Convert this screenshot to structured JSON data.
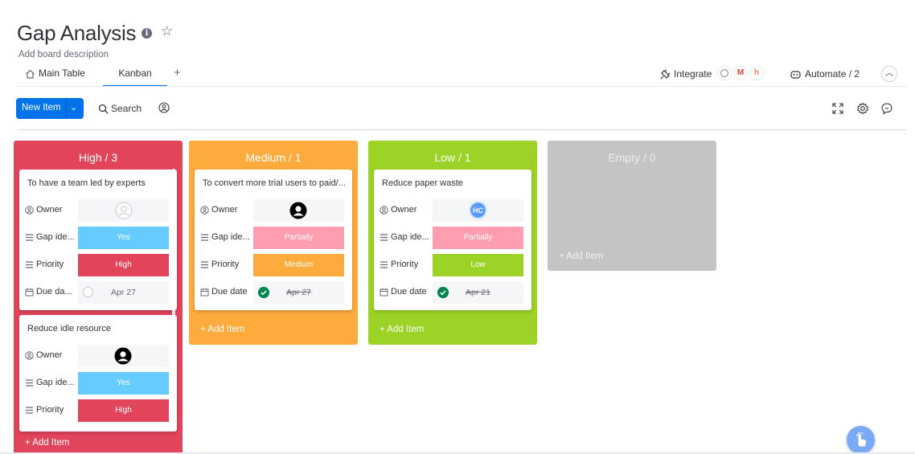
{
  "board": {
    "title": "Gap Analysis",
    "description": "Add board description"
  },
  "tabs": {
    "main_table": "Main Table",
    "kanban": "Kanban",
    "add": "+"
  },
  "header_actions": {
    "integrate": "Integrate",
    "automate": "Automate / 2",
    "integration_logos": [
      "M",
      "h"
    ]
  },
  "toolbar": {
    "new_item": "New Item",
    "search": "Search"
  },
  "colors": {
    "accent": "#0073ea",
    "high": "#e2445c",
    "medium": "#fdab3d",
    "low": "#9cd326",
    "empty": "#c4c4c4",
    "yes": "#66ccff",
    "partially": "#ff9eb0",
    "done_green": "#00854d"
  },
  "columns": [
    {
      "header": "High / 3",
      "add_item": "+ Add Item",
      "cards": [
        {
          "title": "To have a team led by experts",
          "fields": [
            {
              "label": "Owner",
              "value": ""
            },
            {
              "label": "Gap ide...",
              "value": "Yes"
            },
            {
              "label": "Priority",
              "value": "High"
            },
            {
              "label": "Due da...",
              "value": "Apr 27"
            }
          ]
        },
        {
          "title": "Reduce idle resource",
          "fields": [
            {
              "label": "Owner",
              "value": ""
            },
            {
              "label": "Gap ide...",
              "value": "Yes"
            },
            {
              "label": "Priority",
              "value": "High"
            }
          ]
        }
      ]
    },
    {
      "header": "Medium / 1",
      "add_item": "+ Add Item",
      "cards": [
        {
          "title": "To convert more trial users to paid/...",
          "fields": [
            {
              "label": "Owner",
              "value": ""
            },
            {
              "label": "Gap ide...",
              "value": "Partially"
            },
            {
              "label": "Priority",
              "value": "Medium"
            },
            {
              "label": "Due date",
              "value": "Apr 27"
            }
          ]
        }
      ]
    },
    {
      "header": "Low / 1",
      "add_item": "+ Add Item",
      "cards": [
        {
          "title": "Reduce paper waste",
          "fields": [
            {
              "label": "Owner",
              "value": "HC"
            },
            {
              "label": "Gap ide...",
              "value": "Partially"
            },
            {
              "label": "Priority",
              "value": "Low"
            },
            {
              "label": "Due date",
              "value": "Apr 21"
            }
          ]
        }
      ]
    },
    {
      "header": "Empty / 0",
      "add_item": "+ Add Item",
      "cards": []
    }
  ]
}
